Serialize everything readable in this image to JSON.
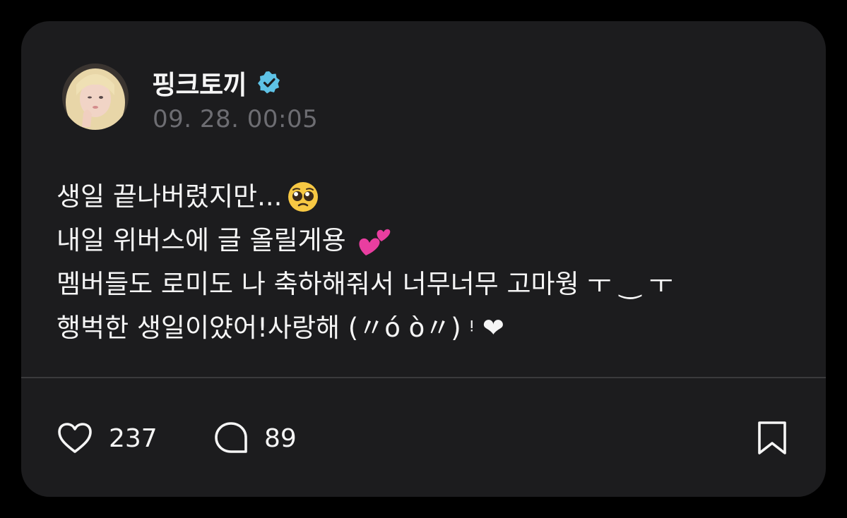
{
  "post": {
    "author": "핑크토끼",
    "verified_icon": "verified-badge-icon",
    "timestamp": "09. 28. 00:05",
    "lines": [
      "생일 끝나버렸지만...",
      "내일 위버스에 글 올릴게용",
      "멤버들도 로미도 나 축하해줘서 너무너무 고마웡 ㅜ ‿ ㅜ",
      "행벅한 생일이얐어!사랑해 (〃ó  ò〃) ᵎ ❤"
    ]
  },
  "actions": {
    "likes": "237",
    "comments": "89",
    "like_icon": "heart-icon",
    "comment_icon": "comment-bubble-icon",
    "bookmark_icon": "bookmark-icon"
  },
  "colors": {
    "background": "#000000",
    "card": "#1c1c1e",
    "text": "#f5f5f5",
    "muted": "#6d6d72",
    "verified": "#5ec2e6"
  }
}
